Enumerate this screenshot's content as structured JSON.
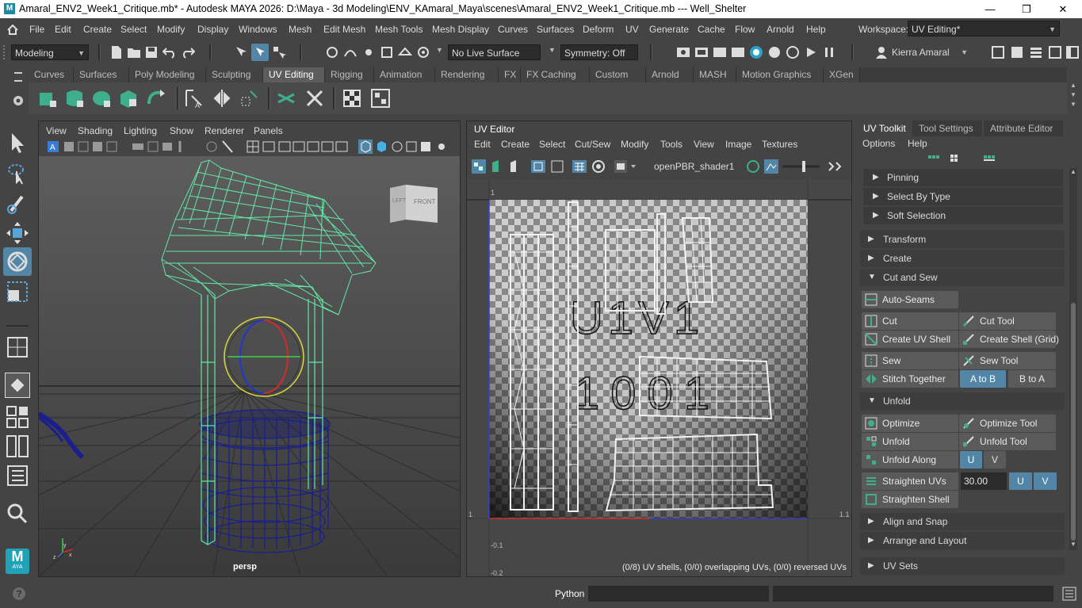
{
  "window": {
    "title": "Amaral_ENV2_Week1_Critique.mb* - Autodesk MAYA 2026: D:\\Maya - 3d Modeling\\ENV_KAmaral_Maya\\scenes\\Amaral_ENV2_Week1_Critique.mb    ---    Well_Shelter",
    "minimize": "—",
    "maximize": "❐",
    "close": "✕"
  },
  "menu": {
    "items": [
      "File",
      "Edit",
      "Create",
      "Select",
      "Modify",
      "Display",
      "Windows",
      "Mesh",
      "Edit Mesh",
      "Mesh Tools",
      "Mesh Display",
      "Curves",
      "Surfaces",
      "Deform",
      "UV",
      "Generate",
      "Cache",
      "Flow",
      "Arnold",
      "Help"
    ],
    "workspace_label": "Workspace:",
    "workspace_value": "UV Editing*"
  },
  "statusline": {
    "mode": "Modeling",
    "live_surface": "No Live Surface",
    "symmetry": "Symmetry: Off",
    "user": "Kierra Amaral"
  },
  "shelf": {
    "tabs": [
      "Curves",
      "Surfaces",
      "Poly Modeling",
      "Sculpting",
      "UV Editing",
      "Rigging",
      "Animation",
      "Rendering",
      "FX",
      "FX Caching",
      "Custom",
      "Arnold",
      "MASH",
      "Motion Graphics",
      "XGen"
    ],
    "active_tab": "UV Editing"
  },
  "viewport": {
    "menus": [
      "View",
      "Shading",
      "Lighting",
      "Show",
      "Renderer",
      "Panels"
    ],
    "camera_label": "persp",
    "viewcube_left": "LEFT",
    "viewcube_front": "FRONT"
  },
  "uv_editor": {
    "title": "UV Editor",
    "menus": [
      "Edit",
      "Create",
      "Select",
      "Cut/Sew",
      "Modify",
      "Tools",
      "View",
      "Image",
      "Textures"
    ],
    "shader": "openPBR_shader1",
    "tile_label_top": "U1V1",
    "tile_label_bottom": "1001",
    "axis_one_top": "1",
    "axis_one_left": "1",
    "axis_one_right": "1.1",
    "axis_neg": "-0.1",
    "axis_neg2": "-0.2",
    "status": "(0/8) UV shells, (0/0) overlapping UVs, (0/0) reversed UVs"
  },
  "uv_toolkit": {
    "tabs": [
      "UV Toolkit",
      "Tool Settings",
      "Attribute Editor"
    ],
    "menus": [
      "Options",
      "Help"
    ],
    "subsections": [
      "Pinning",
      "Select By Type",
      "Soft Selection"
    ],
    "sections": {
      "transform": "Transform",
      "create": "Create",
      "cut_and_sew": "Cut and Sew",
      "unfold": "Unfold",
      "align_snap": "Align and Snap",
      "arrange": "Arrange and Layout",
      "uv_sets": "UV Sets"
    },
    "buttons": {
      "auto_seams": "Auto-Seams",
      "cut": "Cut",
      "cut_tool": "Cut Tool",
      "create_uv_shell": "Create UV Shell",
      "create_shell_grid": "Create Shell (Grid)",
      "sew": "Sew",
      "sew_tool": "Sew Tool",
      "stitch_together": "Stitch Together",
      "a_to_b": "A to B",
      "b_to_a": "B to A",
      "optimize": "Optimize",
      "optimize_tool": "Optimize Tool",
      "unfold": "Unfold",
      "unfold_tool": "Unfold Tool",
      "unfold_along": "Unfold Along",
      "u": "U",
      "v": "V",
      "straighten_uvs": "Straighten UVs",
      "straighten_value": "30.00",
      "straighten_shell": "Straighten Shell"
    }
  },
  "bottom": {
    "help_icon": "?",
    "python_label": "Python"
  },
  "colors": {
    "accent_blue": "#5285a6",
    "wire_green": "#62e8a6",
    "wire_navy": "#1a1f8c"
  }
}
